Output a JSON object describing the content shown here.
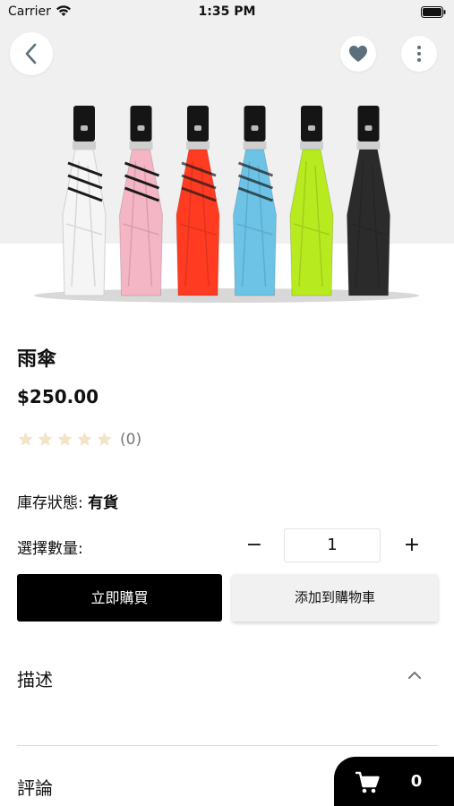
{
  "status_bar": {
    "carrier": "Carrier",
    "time": "1:35 PM"
  },
  "header": {
    "back_icon": "chevron-left-icon",
    "favorite_icon": "heart-icon",
    "more_icon": "more-vertical-icon"
  },
  "product": {
    "title": "雨傘",
    "price": "$250.00",
    "rating": 0,
    "rating_max": 5,
    "review_count": "(0)",
    "stock_label": "庫存狀態:",
    "stock_value": "有貨",
    "image_umbrella_colors": [
      "#f5f5f5",
      "#f4b6c4",
      "#ff3b22",
      "#6cc3e6",
      "#b8ea20",
      "#2b2b2b"
    ]
  },
  "quantity": {
    "label": "選擇數量:",
    "minus": "−",
    "value": "1",
    "plus": "+"
  },
  "actions": {
    "buy_now": "立即購買",
    "add_to_cart": "添加到購物車"
  },
  "sections": {
    "description": "描述",
    "reviews": "評論"
  },
  "cart": {
    "count": "0",
    "icon": "shopping-cart-icon"
  },
  "colors": {
    "primary": "#000000",
    "star_empty": "#f3e3c7",
    "secondary_button_bg": "#f1f1f1"
  }
}
